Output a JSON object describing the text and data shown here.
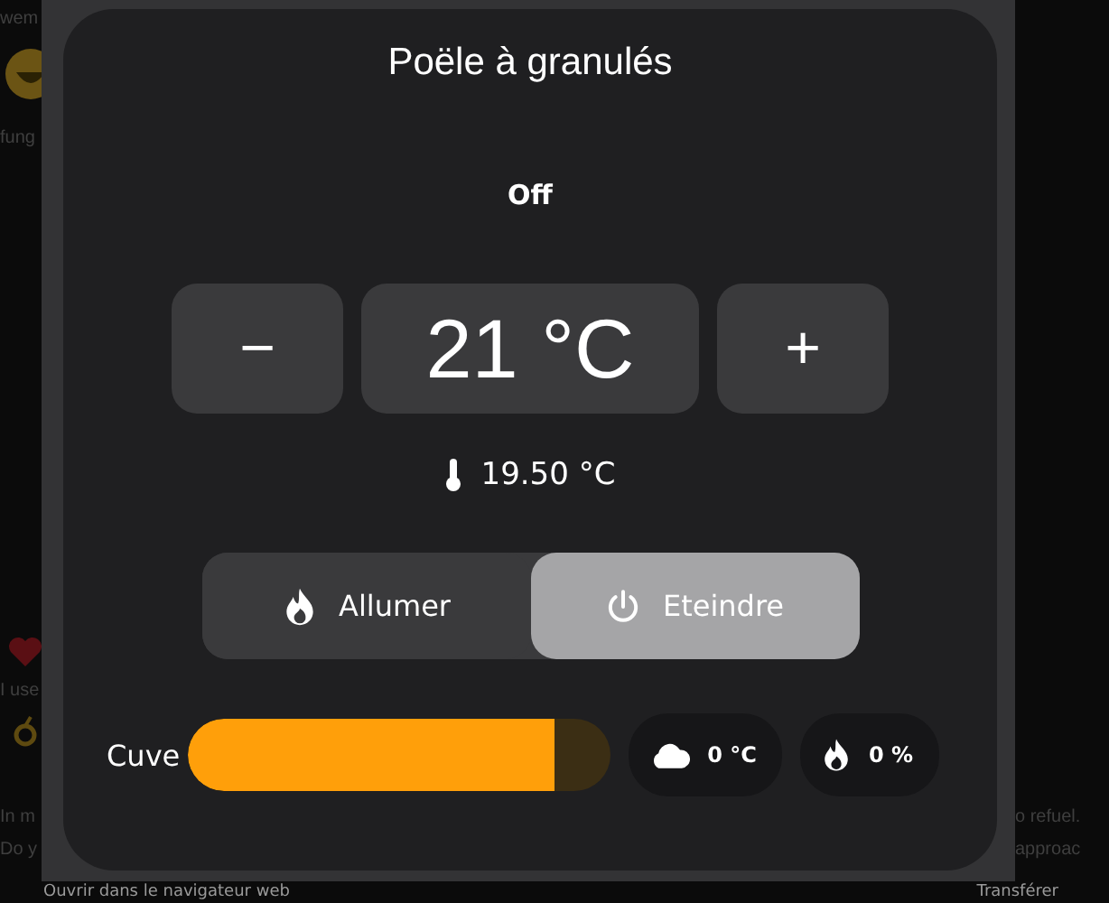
{
  "background": {
    "left_fragments": [
      "wem",
      "fung",
      "I use",
      "In m",
      "Do y"
    ],
    "right_fragments": [
      "o refuel.",
      "approac"
    ],
    "footer": {
      "open_link": "Ouvrir dans le navigateur web",
      "share": "Transférer"
    }
  },
  "dialog": {
    "title": "Poële à granulés",
    "state": "Off",
    "minus": "−",
    "target": "21 °C",
    "plus": "+",
    "current_temperature": "19.50 °C",
    "modes": [
      {
        "kind": "flame",
        "label": "Allumer",
        "selected": false
      },
      {
        "kind": "power",
        "label": "Eteindre",
        "selected": true
      }
    ],
    "tank": {
      "label": "Cuve",
      "level": 0.87
    },
    "sensors": [
      {
        "kind": "cloud",
        "value": "0 °C"
      },
      {
        "kind": "flame",
        "value": "0 %"
      }
    ]
  }
}
